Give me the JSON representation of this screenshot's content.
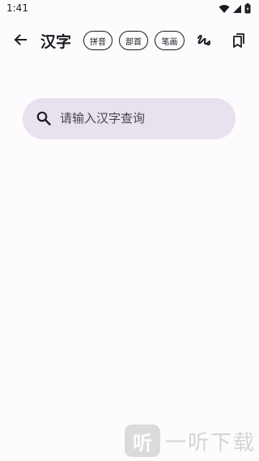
{
  "status_bar": {
    "time": "1:41"
  },
  "app_bar": {
    "title": "汉字",
    "chips": {
      "pinyin": "拼音",
      "bushou": "部首",
      "bihua": "笔画"
    }
  },
  "search": {
    "placeholder": "请输入汉字查询",
    "value": ""
  },
  "watermark": {
    "logo_char": "听",
    "text": "一听下载"
  },
  "colors": {
    "search_bg": "#e8e2ef",
    "background": "#fdfbfe",
    "text": "#1c1b1f"
  }
}
